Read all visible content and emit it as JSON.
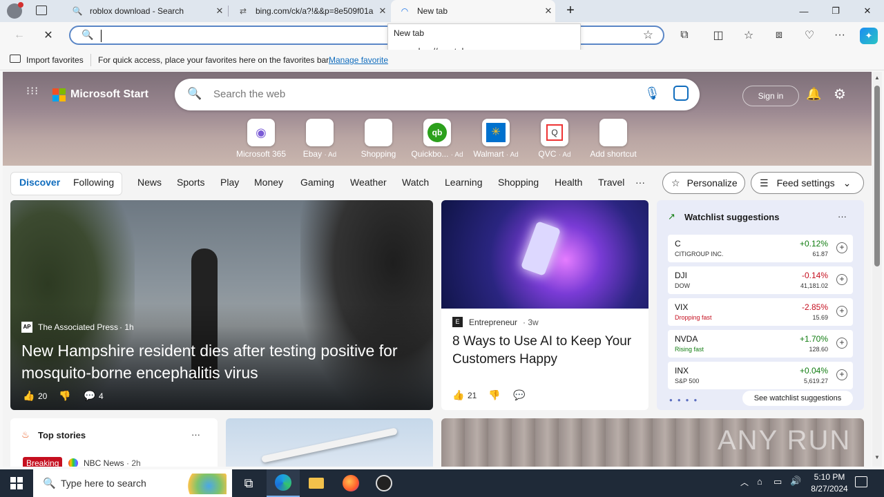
{
  "tabs": [
    {
      "title": "roblox download - Search",
      "icon": "search-icon"
    },
    {
      "title": "bing.com/ck/a?!&&p=8e509f01a",
      "icon": "link-icon"
    },
    {
      "title": "New tab",
      "icon": "loading-icon"
    }
  ],
  "address": {
    "value": "",
    "dropdown_title": "New tab",
    "dropdown_url": "edge://newtab"
  },
  "favorites_bar": {
    "import": "Import favorites",
    "hint": "For quick access, place your favorites here on the favorites bar.",
    "manage": "Manage favorites"
  },
  "msn": {
    "logo": "Microsoft Start",
    "search_placeholder": "Search the web",
    "sign_in": "Sign in",
    "shortcuts": [
      {
        "label": "Microsoft 365",
        "ad": ""
      },
      {
        "label": "Ebay",
        "ad": "· Ad"
      },
      {
        "label": "Shopping",
        "ad": ""
      },
      {
        "label": "Quickbo...",
        "ad": "· Ad"
      },
      {
        "label": "Walmart",
        "ad": "· Ad"
      },
      {
        "label": "QVC",
        "ad": "· Ad"
      },
      {
        "label": "Add shortcut",
        "ad": ""
      }
    ],
    "nav": [
      "Discover",
      "Following",
      "News",
      "Sports",
      "Play",
      "Money",
      "Gaming",
      "Weather",
      "Watch",
      "Learning",
      "Shopping",
      "Health",
      "Travel"
    ],
    "more": "···",
    "personalize": "Personalize",
    "feed_settings": "Feed settings"
  },
  "main_story": {
    "source": "The Associated Press",
    "age": "· 1h",
    "headline": "New Hampshire resident dies after testing positive for mosquito-borne encephalitis virus",
    "likes": "20",
    "comments": "4",
    "source_badge": "AP"
  },
  "second_story": {
    "source": "Entrepreneur",
    "age": "· 3w",
    "headline": "8 Ways to Use AI to Keep Your Customers Happy",
    "likes": "21",
    "source_badge": "E"
  },
  "watchlist": {
    "title": "Watchlist suggestions",
    "more": "···",
    "rows": [
      {
        "symbol": "C",
        "name": "CITIGROUP INC.",
        "change": "+0.12%",
        "price": "61.87",
        "dir": "pos"
      },
      {
        "symbol": "DJI",
        "name": "DOW",
        "change": "-0.14%",
        "price": "41,181.02",
        "dir": "neg"
      },
      {
        "symbol": "VIX",
        "name": "Dropping fast",
        "change": "-2.85%",
        "price": "15.69",
        "dir": "neg"
      },
      {
        "symbol": "NVDA",
        "name": "Rising fast",
        "change": "+1.70%",
        "price": "128.60",
        "dir": "pos"
      },
      {
        "symbol": "INX",
        "name": "S&P 500",
        "change": "+0.04%",
        "price": "5,619.27",
        "dir": "pos"
      }
    ],
    "see_all": "See watchlist suggestions"
  },
  "top_stories": {
    "title": "Top stories",
    "more": "···",
    "breaking": "Breaking",
    "source": "NBC News",
    "age": "· 2h"
  },
  "watermark": "ANY RUN",
  "taskbar": {
    "search_placeholder": "Type here to search",
    "time": "5:10 PM",
    "date": "8/27/2024"
  },
  "colors": {
    "accent": "#0f6cbd",
    "positive": "#107c10",
    "negative": "#c50f1f"
  }
}
